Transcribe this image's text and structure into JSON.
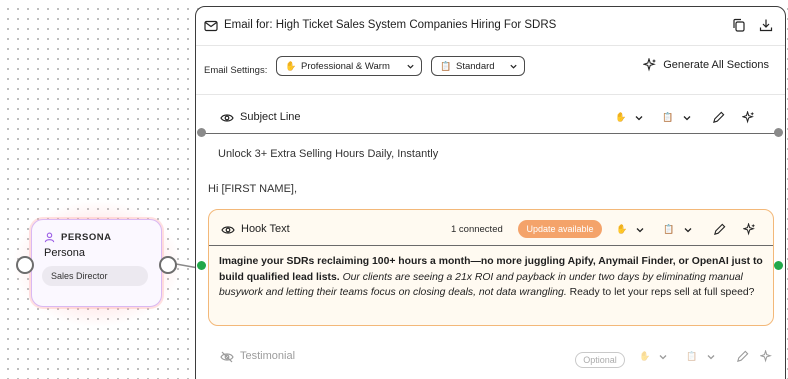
{
  "persona": {
    "tag": "PERSONA",
    "title": "Persona",
    "role": "Sales Director"
  },
  "email": {
    "title": "Email for: High Ticket Sales System Companies Hiring For SDRS",
    "settings_label": "Email Settings:",
    "tone_dropdown": "Professional & Warm",
    "length_dropdown": "Standard",
    "generate_all": "Generate All Sections",
    "subject": {
      "label": "Subject Line",
      "text": "Unlock 3+ Extra Selling Hours Daily, Instantly"
    },
    "greeting": "Hi [FIRST NAME],",
    "hook": {
      "label": "Hook Text",
      "connected": "1 connected",
      "update_badge": "Update available",
      "bold_text": "Imagine your SDRs reclaiming 100+ hours a month—no more juggling Apify, Anymail Finder, or OpenAI just to build qualified lead lists.",
      "italic_text": "Our clients are seeing a 21x ROI and payback in under two days by eliminating manual busywork and letting their teams focus on closing deals, not data wrangling.",
      "plain_text": "Ready to let your reps sell at full speed?"
    },
    "testimonial": {
      "label": "Testimonial",
      "badge": "Optional"
    }
  },
  "icons": {
    "mail": "mail-icon",
    "copy": "copy-icon",
    "download": "download-icon",
    "sparkle": "sparkle-icon",
    "eye": "eye-icon",
    "eye_off": "eye-off-icon",
    "hand": "hand-icon",
    "document": "document-icon",
    "pencil": "pencil-icon",
    "user": "user-icon",
    "chevron": "chevron-down-icon"
  },
  "colors": {
    "persona_accent": "#9b5de5",
    "handle_green": "#22a84a",
    "update_badge": "#f4a36a",
    "hook_border": "#f3b879",
    "hook_bg": "#fffaf1"
  }
}
